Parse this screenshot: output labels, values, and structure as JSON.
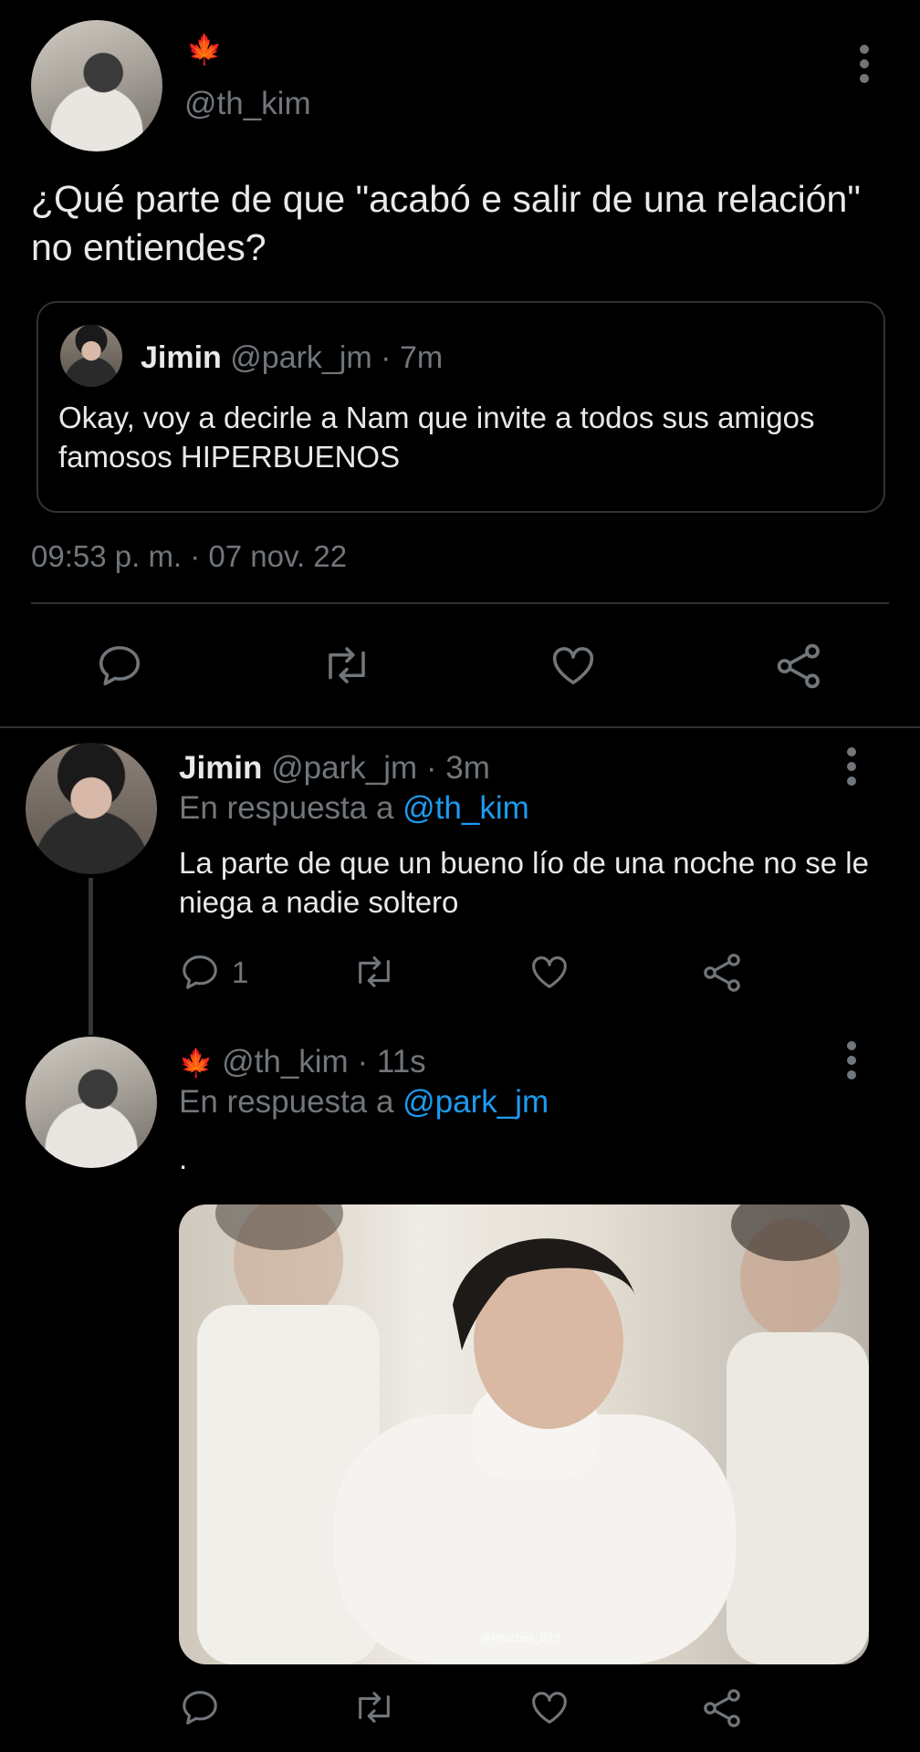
{
  "main_tweet": {
    "display_emoji": "🍁",
    "handle": "@th_kim",
    "text": "¿Qué parte de que \"acabó e salir de una relación\" no entiendes?",
    "quote": {
      "name": "Jimin",
      "handle": "@park_jm",
      "sep": "·",
      "time": "7m",
      "text": "Okay, voy a decirle a Nam que invite a todos sus amigos famosos HIPERBUENOS"
    },
    "timestamp": "09:53 p. m. · 07 nov. 22"
  },
  "reply1": {
    "name": "Jimin",
    "handle": "@park_jm",
    "sep": "·",
    "time": "3m",
    "reply_prefix": "En respuesta a",
    "reply_to": "@th_kim",
    "text": "La parte de que un bueno lío de una noche no se le niega a nadie soltero",
    "reply_count": "1"
  },
  "reply2": {
    "display_emoji": "🍁",
    "handle": "@th_kim",
    "sep": "·",
    "time": "11s",
    "reply_prefix": "En respuesta a",
    "reply_to": "@park_jm",
    "text": ".",
    "media_watermark": "@Peaches_BTS"
  },
  "colors": {
    "background": "#000000",
    "text": "#e7e9ea",
    "secondary": "#71767b",
    "link": "#1d9bf0",
    "border": "#2f3336"
  },
  "icons": [
    "more-vertical-icon",
    "reply-icon",
    "retweet-icon",
    "like-icon",
    "share-icon",
    "maple-leaf-icon"
  ]
}
